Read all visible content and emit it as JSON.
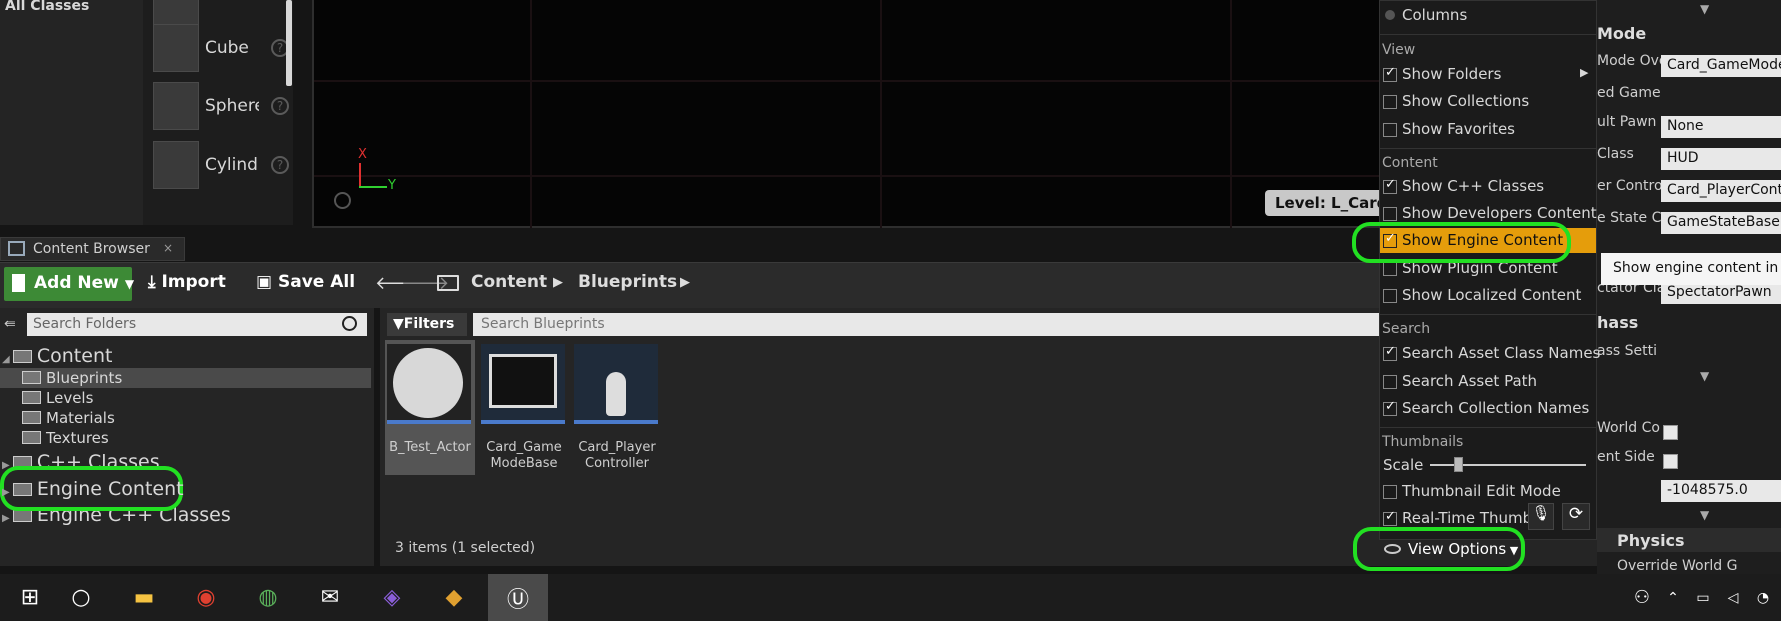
{
  "modes": {
    "all_classes": "All Classes"
  },
  "place_items": [
    {
      "label": "Cube",
      "help": "?"
    },
    {
      "label": "Sphere",
      "help": "?"
    },
    {
      "label": "Cylind",
      "help": "?"
    }
  ],
  "viewport": {
    "axis_x": "X",
    "axis_y": "Y",
    "level_label": "Level:  L_Card_"
  },
  "right_panel": {
    "section_mode": "Mode",
    "rows": [
      {
        "label": "Mode Ove",
        "value": "Card_GameModeB"
      },
      {
        "label": "ed Game",
        "value": ""
      },
      {
        "label": "ult Pawn",
        "value": "None"
      },
      {
        "label": "Class",
        "value": "HUD"
      },
      {
        "label": "er Contro",
        "value": "Card_PlayerContr"
      },
      {
        "label": "e State C",
        "value": "GameStateBase"
      },
      {
        "label": "ctator Cla",
        "value": "SpectatorPawn"
      }
    ],
    "section_class": "hass",
    "class_settings": "ass Setti",
    "world_co": "World Co",
    "ent_side": "ent Side",
    "world_value": "-1048575.0",
    "section_physics": "Physics",
    "override_world": "Override World G"
  },
  "content_browser": {
    "tab_title": "Content Browser",
    "close": "×",
    "toolbar": {
      "add_new": "Add New",
      "import": "Import",
      "save_all": "Save All"
    },
    "breadcrumb": {
      "root": "Content",
      "current": "Blueprints"
    },
    "search_folders_placeholder": "Search Folders",
    "search_assets_placeholder": "Search Blueprints",
    "filters_label": "Filters",
    "tree": {
      "content": "Content",
      "blueprints": "Blueprints",
      "levels": "Levels",
      "materials": "Materials",
      "textures": "Textures",
      "cpp_classes": "C++ Classes",
      "engine_content": "Engine Content",
      "engine_cpp_classes": "Engine C++ Classes"
    },
    "assets": [
      {
        "name": "B_Test_Actor"
      },
      {
        "name": "Card_Game ModeBase"
      },
      {
        "name": "Card_Player Controller"
      }
    ],
    "item_count": "3 items (1 selected)"
  },
  "view_menu": {
    "columns": "Columns",
    "header_view": "View",
    "show_folders": "Show Folders",
    "show_collections": "Show Collections",
    "show_favorites": "Show Favorites",
    "header_content": "Content",
    "show_cpp_classes": "Show C++ Classes",
    "show_developers_content": "Show Developers Content",
    "show_engine_content": "Show Engine Content",
    "show_plugin_content": "Show Plugin Content",
    "show_localized_content": "Show Localized Content",
    "header_search": "Search",
    "search_asset_class_names": "Search Asset Class Names",
    "search_asset_path": "Search Asset Path",
    "search_collection_names": "Search Collection Names",
    "header_thumbnails": "Thumbnails",
    "scale_label": "Scale",
    "scale_value": 0.18,
    "thumbnail_edit_mode": "Thumbnail Edit Mode",
    "realtime_thumbnails": "Real-Time Thumbn",
    "view_options": "View Options",
    "tooltip": "Show engine content in the"
  },
  "highlight_color": "#22e022",
  "accent_color": "#e59d0b"
}
